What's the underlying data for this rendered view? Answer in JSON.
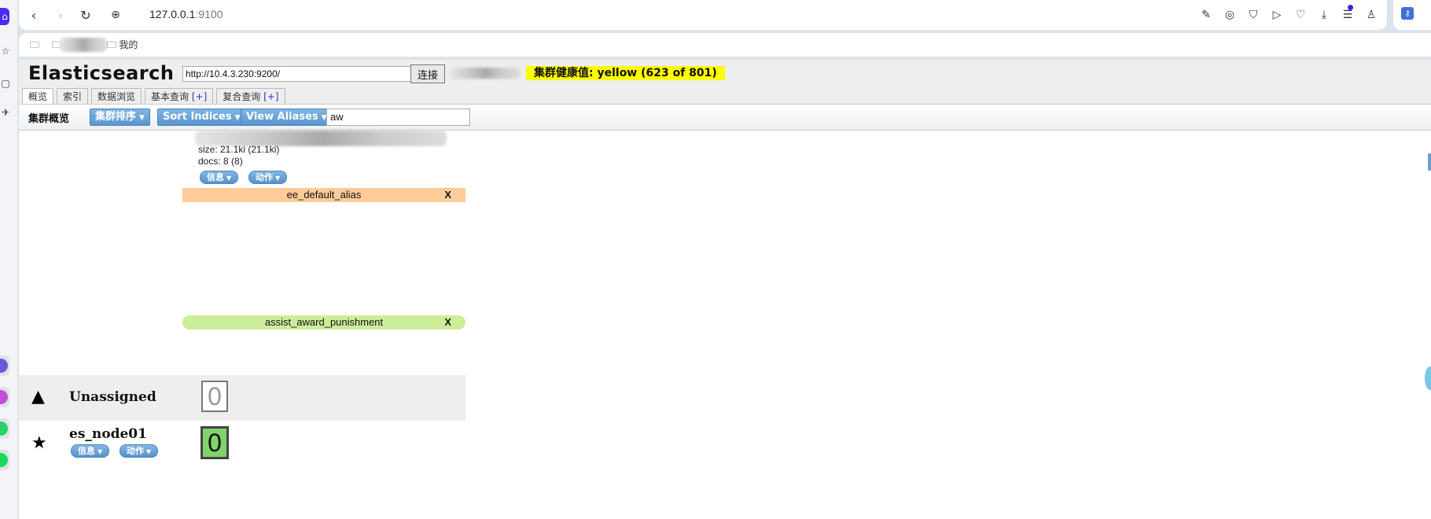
{
  "browser": {
    "url_host": "127.0.0.1",
    "url_port": ":9100",
    "bookmarks": [
      {
        "label": ""
      },
      {
        "label": "我的"
      }
    ]
  },
  "app": {
    "title": "Elasticsearch",
    "connect_url": "http://10.4.3.230:9200/",
    "connect_label": "连接",
    "health": "集群健康值: yellow (623 of 801)",
    "health_color": "#ffff00",
    "tabs": [
      {
        "label": "概览",
        "plus": ""
      },
      {
        "label": "索引",
        "plus": ""
      },
      {
        "label": "数据浏览",
        "plus": ""
      },
      {
        "label": "基本查询 ",
        "plus": "[+]"
      },
      {
        "label": "复合查询 ",
        "plus": "[+]"
      }
    ],
    "toolbar": {
      "label": "集群概览",
      "sort_cluster": "集群排序",
      "sort_indices": "Sort Indices",
      "view_aliases": "View Aliases",
      "filter_value": "aw"
    }
  },
  "index": {
    "size": "size: 21.1ki (21.1ki)",
    "docs": "docs: 8 (8)",
    "info_label": "信息",
    "action_label": "动作"
  },
  "aliases": [
    {
      "name": "ee_default_alias",
      "color": "#ffcc99",
      "close": "X"
    },
    {
      "name": "assist_award_punishment",
      "color": "#ccee99",
      "close": "X"
    }
  ],
  "nodes": [
    {
      "name": "Unassigned",
      "shard_count": "0"
    },
    {
      "name": "es_node01",
      "shard_count": "0",
      "info_label": "信息",
      "action_label": "动作"
    }
  ]
}
